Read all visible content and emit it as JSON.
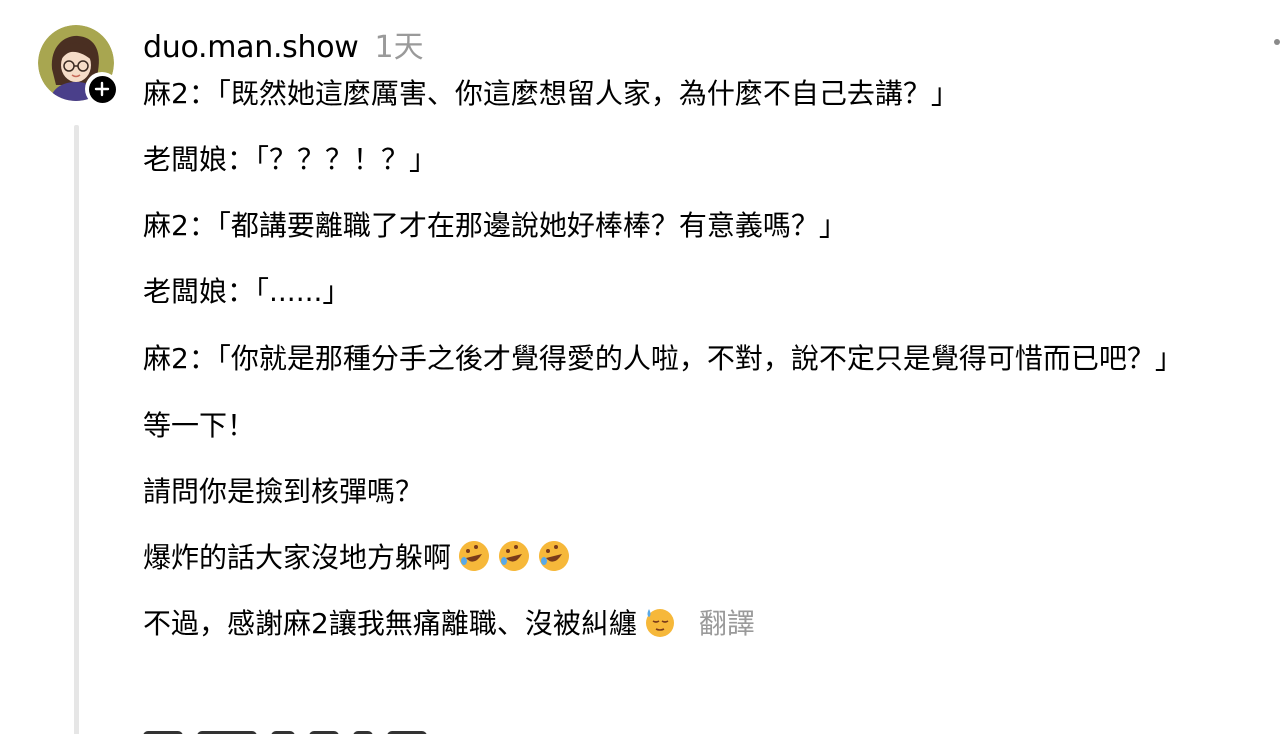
{
  "post": {
    "username": "duo.man.show",
    "time_ago": "1天",
    "lines": [
      "麻2：「既然她這麼厲害、你這麼想留人家，為什麼不自己去講？」",
      "老闆娘：「？？？！？」",
      "麻2：「都講要離職了才在那邊說她好棒棒？有意義嗎？」",
      "老闆娘：「......」",
      "麻2：「你就是那種分手之後才覺得愛的人啦，不對，說不定只是覺得可惜而已吧？」",
      "等一下！",
      "請問你是撿到核彈嗎？",
      "爆炸的話大家沒地方躲啊",
      "不過，感謝麻2讓我無痛離職、沒被糾纏"
    ],
    "translate_label": "翻譯"
  },
  "icons": {
    "avatar": "avatar-illustration",
    "follow": "plus-icon",
    "more": "more-dots-icon",
    "laugh_emoji": "rolling-on-floor-laughing-emoji",
    "relieved_emoji": "relieved-sweat-emoji"
  },
  "colors": {
    "text": "#000000",
    "muted": "#9a9a9a",
    "thread_line": "#e6e6e6"
  }
}
